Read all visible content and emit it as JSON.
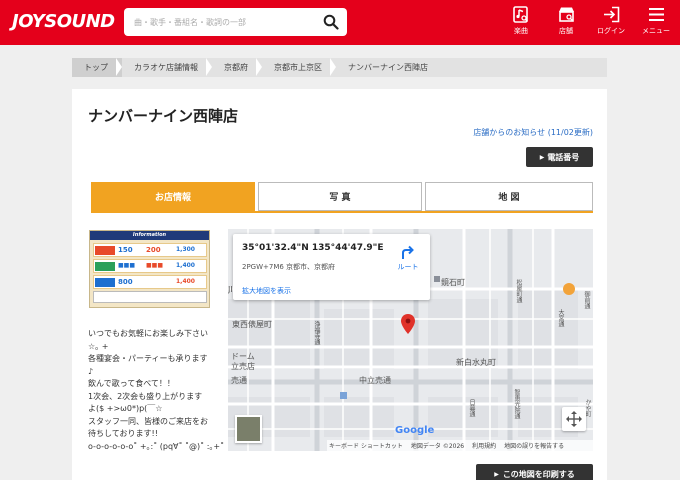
{
  "header": {
    "logo": "JOYSOUND",
    "search_placeholder": "曲・歌手・番組名・歌詞の一部",
    "nav": [
      {
        "label": "楽曲",
        "icon": "music-search-icon"
      },
      {
        "label": "店舗",
        "icon": "store-search-icon"
      },
      {
        "label": "ログイン",
        "icon": "login-icon"
      },
      {
        "label": "メニュー",
        "icon": "menu-icon"
      }
    ],
    "colors": {
      "brand": "#e4001b"
    }
  },
  "breadcrumb": [
    "トップ",
    "カラオケ店舗情報",
    "京都府",
    "京都市上京区",
    "ナンバーナイン西陣店"
  ],
  "store": {
    "name": "ナンバーナイン西陣店",
    "notice": "店舗からのお知らせ (11/02更新)",
    "phone_button": "電話番号",
    "print_button": "この地図を印刷する"
  },
  "tabs": [
    {
      "label": "お店情報",
      "active": true
    },
    {
      "label": "写 真",
      "active": false
    },
    {
      "label": "地 図",
      "active": false
    }
  ],
  "flyer": {
    "heading": "Information",
    "prices": [
      "150",
      "200",
      "1,300",
      "1,400",
      "800",
      "1,400"
    ]
  },
  "message_lines": [
    "いつでもお気軽にお楽しみ下さい",
    "☆｡ +",
    "",
    "各種宴会・パーティーも承ります",
    "♪",
    "飲んで歌って食べて！！",
    "1次会、2次会も盛り上がります",
    "よ($ +>ω0*)p(￣☆",
    "",
    "スタッフ一同、皆様のご来店をお",
    "待ちしております!!",
    "o-o-o-o-o-o˚ +｡:˚ (pq∀˚ ˚@)˚ :｡+˚"
  ],
  "map": {
    "coordinates": "35°01'32.4\"N 135°44'47.9\"E",
    "plus_code": "2PGW+7M6 京都市、京都府",
    "route_label": "ルート",
    "enlarge_link": "拡大地図を表示",
    "labels": {
      "kyoto_ishi": "鏡石町",
      "higashi": "東西俵屋町",
      "shinshiro": "新白水丸町",
      "nakadachiuri": "中立売通",
      "uri": "売通",
      "ji": "JI",
      "dome": "ドーム",
      "dome_sub": "立売店",
      "omiya": "大宮通",
      "jofuku": "浄福寺通",
      "chiekoin": "智恵光院通",
      "hinokuchi": "日暮通",
      "matsuya": "松屋町通",
      "gotei": "御前通",
      "kayamachi": "かや町"
    },
    "google_label": "Google",
    "attribution": [
      "キーボード ショートカット",
      "地図データ ©2026",
      "利用規約",
      "地図の誤りを報告する"
    ]
  }
}
